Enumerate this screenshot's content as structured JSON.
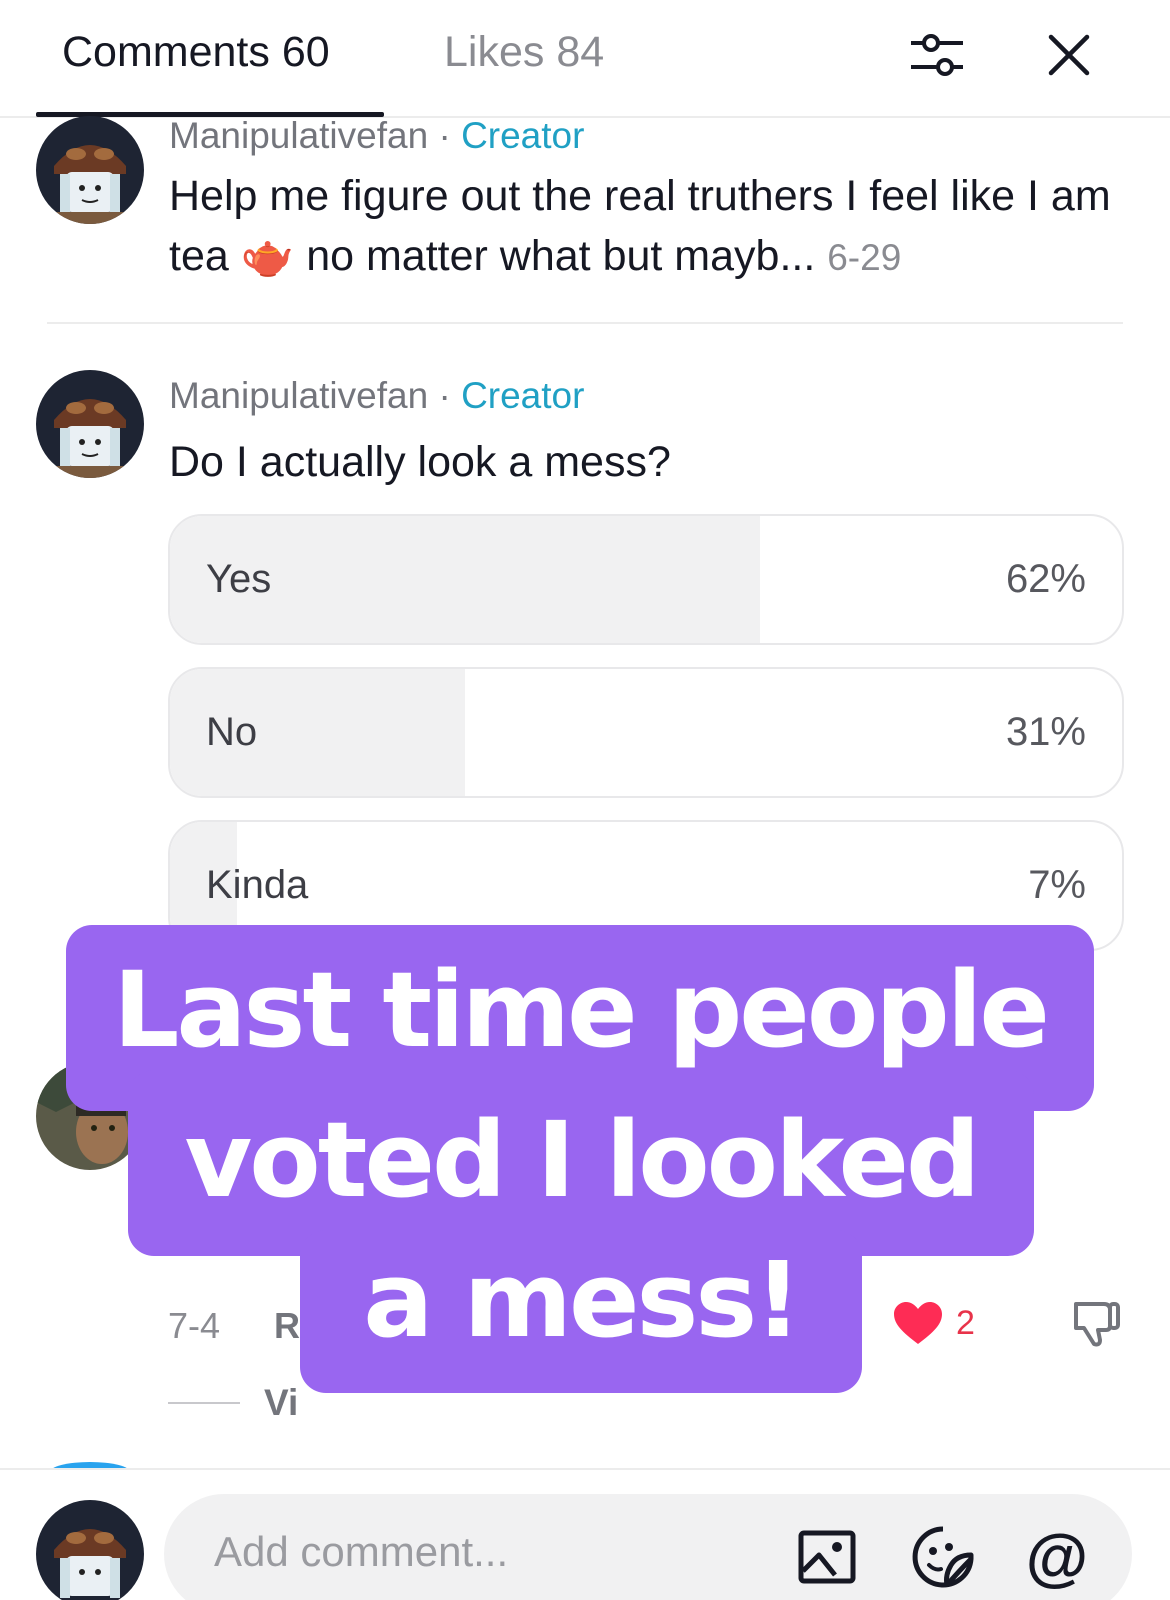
{
  "header": {
    "comments_tab": "Comments 60",
    "likes_tab": "Likes 84",
    "filter_icon": "filter-sliders-icon",
    "close_icon": "close-icon"
  },
  "comment_1": {
    "author": "Manipulativefan",
    "separator": " · ",
    "badge": "Creator",
    "text": "Help me figure out the real truthers I feel like I am tea 🫖 no matter what but mayb...",
    "date": "6-29"
  },
  "comment_2": {
    "author": "Manipulativefan",
    "separator": " · ",
    "badge": "Creator",
    "text": "Do I actually look a mess?",
    "poll": [
      {
        "label": "Yes",
        "percent": "62%",
        "fraction": 0.62
      },
      {
        "label": "No",
        "percent": "31%",
        "fraction": 0.31
      },
      {
        "label": "Kinda",
        "percent": "7%",
        "fraction": 0.07
      }
    ]
  },
  "comment_3": {
    "date": "7-4",
    "reply_partial": "Re",
    "likes": "2",
    "view_partial": "Vi"
  },
  "caption": {
    "line1": "Last time people",
    "line2": "voted I looked",
    "line3": "a mess!"
  },
  "footer": {
    "input_placeholder": "Add comment...",
    "image_icon": "image-icon",
    "sticker_icon": "sticker-icon",
    "mention_label": "@"
  },
  "colors": {
    "creator_badge": "#20a0c4",
    "caption_bg": "#9966f0",
    "like_red": "#e8334a",
    "poll_fill": "#f1f1f2"
  }
}
